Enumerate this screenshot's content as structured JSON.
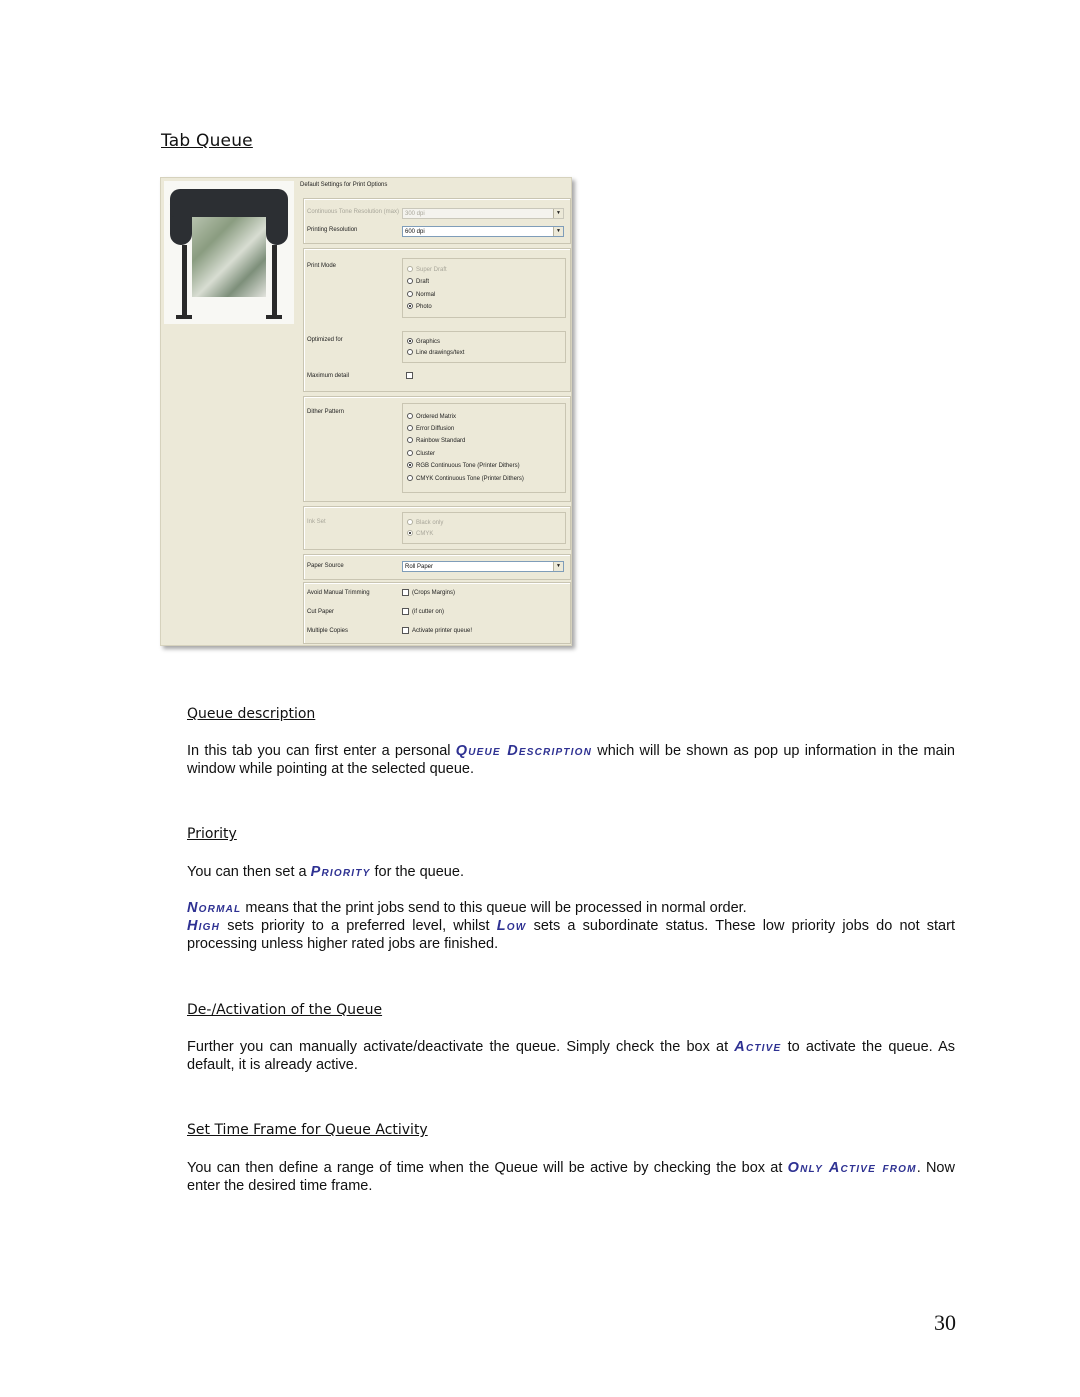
{
  "page": {
    "title": "Tab Queue",
    "page_number": "30"
  },
  "screenshot": {
    "image_alt": "large-format printer",
    "panel_title": "Default Settings for Print Options",
    "continuous_tone_label": "Continuous Tone Resolution (max)",
    "continuous_tone_value": "300 dpi",
    "printing_resolution_label": "Printing Resolution",
    "printing_resolution_value": "600 dpi",
    "print_mode_label": "Print Mode",
    "print_mode_options": [
      "Super Draft",
      "Draft",
      "Normal",
      "Photo"
    ],
    "print_mode_selected": "Photo",
    "optimized_for_label": "Optimized for",
    "optimized_for_options": [
      "Graphics",
      "Line drawings/text"
    ],
    "optimized_for_selected": "Graphics",
    "maximum_detail_label": "Maximum detail",
    "maximum_detail_checked": false,
    "dither_pattern_label": "Dither Pattern",
    "dither_options": [
      "Ordered Matrix",
      "Error Diffusion",
      "Rainbow Standard",
      "Cluster",
      "RGB Continuous Tone (Printer Dithers)",
      "CMYK Continuous Tone (Printer Dithers)"
    ],
    "dither_selected": "RGB Continuous Tone (Printer Dithers)",
    "ink_set_label": "Ink Set",
    "ink_set_options": [
      "Black only",
      "CMYK"
    ],
    "ink_set_selected": "CMYK",
    "paper_source_label": "Paper Source",
    "paper_source_value": "Roll Paper",
    "avoid_trimming_label": "Avoid Manual Trimming",
    "avoid_trimming_option": "(Crops Margins)",
    "cut_paper_label": "Cut Paper",
    "cut_paper_option": "(if cutter on)",
    "multiple_copies_label": "Multiple Copies",
    "multiple_copies_option": "Activate printer queue!"
  },
  "sections": {
    "queue_description": {
      "heading": "Queue description",
      "text_1": "In this tab you can first enter a personal ",
      "kw_1": "Queue Description",
      "text_2": " which will be shown as pop up information in the main window while pointing at the selected queue."
    },
    "priority": {
      "heading": "Priority",
      "p1_text_1": "You can then set a ",
      "p1_kw_1": "Priority",
      "p1_text_2": " for the queue.",
      "p2_kw_1": "Normal",
      "p2_text_1": " means that the print jobs send to this queue will be processed in normal order.",
      "p3_kw_1": "High",
      "p3_text_1": " sets priority to a preferred level, whilst ",
      "p3_kw_2": "Low",
      "p3_text_2": " sets a subordinate status. These low priority jobs do not start processing unless higher rated jobs are finished."
    },
    "activation": {
      "heading": "De-/Activation of the Queue",
      "text_1": "Further you can manually activate/deactivate the queue. Simply check the box at ",
      "kw_1": "Active",
      "text_2": " to activate the queue. As default, it is already active."
    },
    "time_frame": {
      "heading": "Set Time Frame for Queue Activity",
      "text_1": "You can then define a range of time when the Queue will be active by checking the box at ",
      "kw_1": "Only Active from",
      "text_2": ". Now enter the desired time frame."
    }
  },
  "colors": {
    "keyword": "#2e3192",
    "panel_bg": "#ece9d8"
  }
}
